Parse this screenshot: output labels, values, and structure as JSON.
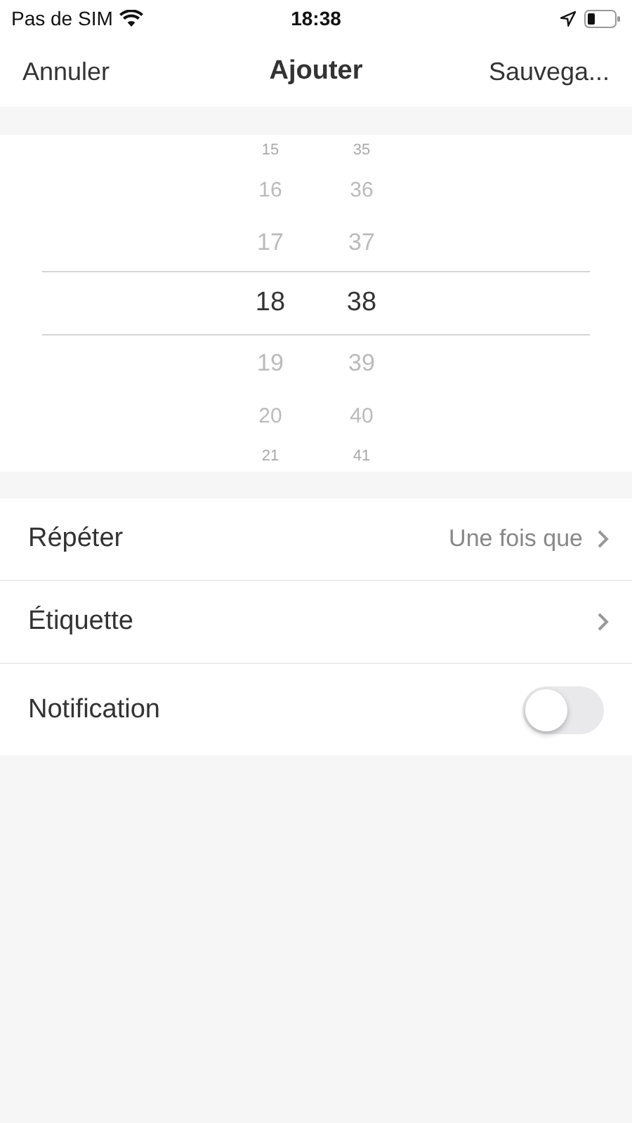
{
  "status_bar": {
    "carrier": "Pas de SIM",
    "time": "18:38"
  },
  "nav": {
    "cancel": "Annuler",
    "title": "Ajouter",
    "save": "Sauvega..."
  },
  "picker": {
    "rows": [
      {
        "hour": "15",
        "minute": "35",
        "selected": false
      },
      {
        "hour": "16",
        "minute": "36",
        "selected": false
      },
      {
        "hour": "17",
        "minute": "37",
        "selected": false
      },
      {
        "hour": "18",
        "minute": "38",
        "selected": true
      },
      {
        "hour": "19",
        "minute": "39",
        "selected": false
      },
      {
        "hour": "20",
        "minute": "40",
        "selected": false
      },
      {
        "hour": "21",
        "minute": "41",
        "selected": false
      }
    ]
  },
  "settings": [
    {
      "kind": "link",
      "label": "Répéter",
      "value": "Une fois que"
    },
    {
      "kind": "link",
      "label": "Étiquette"
    },
    {
      "kind": "toggle",
      "label": "Notification",
      "on": false
    }
  ]
}
